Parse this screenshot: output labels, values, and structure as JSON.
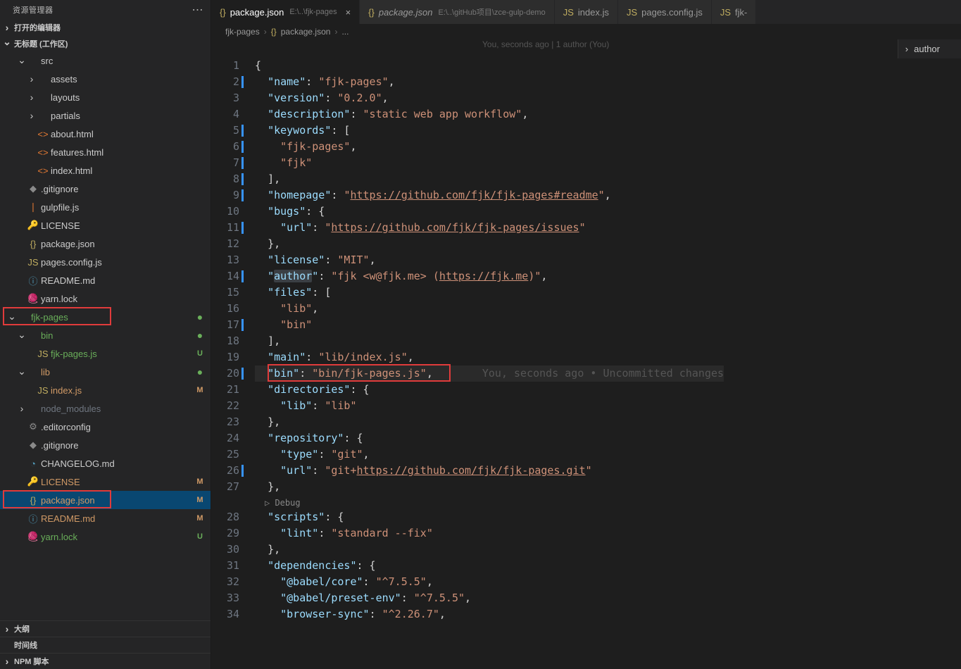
{
  "sidebar": {
    "title": "资源管理器",
    "open_editors": "打开的编辑器",
    "workspace": "无标题 (工作区)",
    "rows": [
      {
        "d": 1,
        "tw": "open",
        "ico": "",
        "lbl": "src",
        "cls": ""
      },
      {
        "d": 2,
        "tw": "closed",
        "ico": "",
        "lbl": "assets",
        "cls": ""
      },
      {
        "d": 2,
        "tw": "closed",
        "ico": "",
        "lbl": "layouts",
        "cls": ""
      },
      {
        "d": 2,
        "tw": "closed",
        "ico": "",
        "lbl": "partials",
        "cls": ""
      },
      {
        "d": 2,
        "tw": "leaf",
        "ico": "<>",
        "iclr": "c-orange",
        "lbl": "about.html",
        "cls": ""
      },
      {
        "d": 2,
        "tw": "leaf",
        "ico": "<>",
        "iclr": "c-orange",
        "lbl": "features.html",
        "cls": ""
      },
      {
        "d": 2,
        "tw": "leaf",
        "ico": "<>",
        "iclr": "c-orange",
        "lbl": "index.html",
        "cls": ""
      },
      {
        "d": 1,
        "tw": "leaf",
        "ico": "◆",
        "iclr": "c-grey",
        "lbl": ".gitignore",
        "cls": ""
      },
      {
        "d": 1,
        "tw": "leaf",
        "ico": "❘",
        "iclr": "c-orange",
        "lbl": "gulpfile.js",
        "cls": ""
      },
      {
        "d": 1,
        "tw": "leaf",
        "ico": "🔑",
        "iclr": "c-yellow",
        "lbl": "LICENSE",
        "cls": ""
      },
      {
        "d": 1,
        "tw": "leaf",
        "ico": "{}",
        "iclr": "c-yellow",
        "lbl": "package.json",
        "cls": ""
      },
      {
        "d": 1,
        "tw": "leaf",
        "ico": "JS",
        "iclr": "c-yellow",
        "lbl": "pages.config.js",
        "cls": ""
      },
      {
        "d": 1,
        "tw": "leaf",
        "ico": "ⓘ",
        "iclr": "c-lightblue",
        "lbl": "README.md",
        "cls": ""
      },
      {
        "d": 1,
        "tw": "leaf",
        "ico": "🧶",
        "iclr": "c-purple",
        "lbl": "yarn.lock",
        "cls": ""
      },
      {
        "d": 0,
        "tw": "open",
        "ico": "",
        "lbl": "fjk-pages",
        "cls": "git-unt",
        "git": "dot",
        "hl": "box1"
      },
      {
        "d": 1,
        "tw": "open",
        "ico": "",
        "lbl": "bin",
        "cls": "git-unt",
        "git": "dot"
      },
      {
        "d": 2,
        "tw": "leaf",
        "ico": "JS",
        "iclr": "c-yellow",
        "lbl": "fjk-pages.js",
        "cls": "git-unt",
        "git": "U"
      },
      {
        "d": 1,
        "tw": "open",
        "ico": "",
        "lbl": "lib",
        "cls": "git-mod",
        "git": "dot"
      },
      {
        "d": 2,
        "tw": "leaf",
        "ico": "JS",
        "iclr": "c-yellow",
        "lbl": "index.js",
        "cls": "git-mod",
        "git": "M"
      },
      {
        "d": 1,
        "tw": "closed",
        "ico": "",
        "lbl": "node_modules",
        "cls": "dim"
      },
      {
        "d": 1,
        "tw": "leaf",
        "ico": "⚙",
        "iclr": "c-grey",
        "lbl": ".editorconfig",
        "cls": ""
      },
      {
        "d": 1,
        "tw": "leaf",
        "ico": "◆",
        "iclr": "c-grey",
        "lbl": ".gitignore",
        "cls": ""
      },
      {
        "d": 1,
        "tw": "leaf",
        "ico": "◔",
        "iclr": "c-lightblue",
        "lbl": "CHANGELOG.md",
        "cls": ""
      },
      {
        "d": 1,
        "tw": "leaf",
        "ico": "🔑",
        "iclr": "c-yellow",
        "lbl": "LICENSE",
        "cls": "git-mod",
        "git": "M"
      },
      {
        "d": 1,
        "tw": "leaf",
        "ico": "{}",
        "iclr": "c-yellow",
        "lbl": "package.json",
        "cls": "git-mod sel",
        "git": "M",
        "hl": "box2"
      },
      {
        "d": 1,
        "tw": "leaf",
        "ico": "ⓘ",
        "iclr": "c-lightblue",
        "lbl": "README.md",
        "cls": "git-mod",
        "git": "M"
      },
      {
        "d": 1,
        "tw": "leaf",
        "ico": "🧶",
        "iclr": "c-purple",
        "lbl": "yarn.lock",
        "cls": "git-unt",
        "git": "U"
      }
    ],
    "bottom": [
      {
        "tw": "closed",
        "lbl": "大纲"
      },
      {
        "tw": "none",
        "lbl": "时间线"
      },
      {
        "tw": "closed",
        "lbl": "NPM 脚本"
      }
    ]
  },
  "tabs": [
    {
      "ico": "{}",
      "iclr": "tico-json",
      "name": "package.json",
      "sub": "E:\\..\\fjk-pages",
      "active": true,
      "close": true
    },
    {
      "ico": "{}",
      "iclr": "tico-json",
      "name": "package.json",
      "sub": "E:\\..\\gitHub项目\\zce-gulp-demo",
      "italic": true
    },
    {
      "ico": "JS",
      "iclr": "tico-js",
      "name": "index.js"
    },
    {
      "ico": "JS",
      "iclr": "tico-js",
      "name": "pages.config.js"
    },
    {
      "ico": "JS",
      "iclr": "tico-js",
      "name": "fjk-"
    }
  ],
  "breadcrumbs": [
    "fjk-pages",
    "›",
    "{}",
    "package.json",
    "›",
    "..."
  ],
  "blame_top": "You, seconds ago | 1 author (You)",
  "outline_label": "author",
  "inline_blame": "You, seconds ago • Uncommitted changes",
  "debug_label": "Debug",
  "code": [
    {
      "n": 1,
      "mod": false,
      "html": "<span class='tok-punc'>{</span>"
    },
    {
      "n": 2,
      "mod": true,
      "html": "  <span class='tok-key'>\"name\"</span><span class='tok-punc'>: </span><span class='tok-str'>\"fjk-pages\"</span><span class='tok-punc'>,</span>"
    },
    {
      "n": 3,
      "mod": false,
      "html": "  <span class='tok-key'>\"version\"</span><span class='tok-punc'>: </span><span class='tok-str'>\"0.2.0\"</span><span class='tok-punc'>,</span>"
    },
    {
      "n": 4,
      "mod": false,
      "html": "  <span class='tok-key'>\"description\"</span><span class='tok-punc'>: </span><span class='tok-str'>\"static web app workflow\"</span><span class='tok-punc'>,</span>"
    },
    {
      "n": 5,
      "mod": true,
      "html": "  <span class='tok-key'>\"keywords\"</span><span class='tok-punc'>: [</span>"
    },
    {
      "n": 6,
      "mod": true,
      "html": "    <span class='tok-str'>\"fjk-pages\"</span><span class='tok-punc'>,</span>"
    },
    {
      "n": 7,
      "mod": true,
      "html": "    <span class='tok-str'>\"fjk\"</span>"
    },
    {
      "n": 8,
      "mod": true,
      "html": "  <span class='tok-punc'>],</span>"
    },
    {
      "n": 9,
      "mod": true,
      "html": "  <span class='tok-key'>\"homepage\"</span><span class='tok-punc'>: </span><span class='tok-str'>\"<span class='tok-link'>https://github.com/fjk/fjk-pages#readme</span>\"</span><span class='tok-punc'>,</span>"
    },
    {
      "n": 10,
      "mod": false,
      "html": "  <span class='tok-key'>\"bugs\"</span><span class='tok-punc'>: {</span>"
    },
    {
      "n": 11,
      "mod": true,
      "html": "    <span class='tok-key'>\"url\"</span><span class='tok-punc'>: </span><span class='tok-str'>\"<span class='tok-link'>https://github.com/fjk/fjk-pages/issues</span>\"</span>"
    },
    {
      "n": 12,
      "mod": false,
      "html": "  <span class='tok-punc'>},</span>"
    },
    {
      "n": 13,
      "mod": false,
      "html": "  <span class='tok-key'>\"license\"</span><span class='tok-punc'>: </span><span class='tok-str'>\"MIT\"</span><span class='tok-punc'>,</span>"
    },
    {
      "n": 14,
      "mod": true,
      "html": "  <span class='tok-key'>\"<span class='sel-word'>author</span>\"</span><span class='tok-punc'>: </span><span class='tok-str'>\"fjk &lt;w@fjk.me&gt; (<span class='tok-link'>https://fjk.me</span>)\"</span><span class='tok-punc'>,</span>"
    },
    {
      "n": 15,
      "mod": false,
      "html": "  <span class='tok-key'>\"files\"</span><span class='tok-punc'>: [</span>"
    },
    {
      "n": 16,
      "mod": false,
      "html": "    <span class='tok-str'>\"lib\"</span><span class='tok-punc'>,</span>"
    },
    {
      "n": 17,
      "mod": true,
      "html": "    <span class='tok-str'>\"bin\"</span>"
    },
    {
      "n": 18,
      "mod": false,
      "html": "  <span class='tok-punc'>],</span>"
    },
    {
      "n": 19,
      "mod": false,
      "html": "  <span class='tok-key'>\"main\"</span><span class='tok-punc'>: </span><span class='tok-str'>\"lib/index.js\"</span><span class='tok-punc'>,</span>"
    },
    {
      "n": 20,
      "mod": true,
      "cur": true,
      "html": "  <span class='tok-key'>\"bin\"</span><span class='tok-punc'>: </span><span class='tok-str'>\"bin/fjk-pages.js\"</span><span class='tok-punc'>,</span><span class='inline-blame'>You, seconds ago • Uncommitted changes</span>"
    },
    {
      "n": 21,
      "mod": false,
      "html": "  <span class='tok-key'>\"directories\"</span><span class='tok-punc'>: {</span>"
    },
    {
      "n": 22,
      "mod": false,
      "html": "    <span class='tok-key'>\"lib\"</span><span class='tok-punc'>: </span><span class='tok-str'>\"lib\"</span>"
    },
    {
      "n": 23,
      "mod": false,
      "html": "  <span class='tok-punc'>},</span>"
    },
    {
      "n": 24,
      "mod": false,
      "html": "  <span class='tok-key'>\"repository\"</span><span class='tok-punc'>: {</span>"
    },
    {
      "n": 25,
      "mod": false,
      "html": "    <span class='tok-key'>\"type\"</span><span class='tok-punc'>: </span><span class='tok-str'>\"git\"</span><span class='tok-punc'>,</span>"
    },
    {
      "n": 26,
      "mod": true,
      "html": "    <span class='tok-key'>\"url\"</span><span class='tok-punc'>: </span><span class='tok-str'>\"git+<span class='tok-link'>https://github.com/fjk/fjk-pages.git</span>\"</span>"
    },
    {
      "n": 27,
      "mod": false,
      "html": "  <span class='tok-punc'>},</span>"
    },
    {
      "debug": true
    },
    {
      "n": 28,
      "mod": false,
      "html": "  <span class='tok-key'>\"scripts\"</span><span class='tok-punc'>: {</span>"
    },
    {
      "n": 29,
      "mod": false,
      "html": "    <span class='tok-key'>\"lint\"</span><span class='tok-punc'>: </span><span class='tok-str'>\"standard --fix\"</span>"
    },
    {
      "n": 30,
      "mod": false,
      "html": "  <span class='tok-punc'>},</span>"
    },
    {
      "n": 31,
      "mod": false,
      "html": "  <span class='tok-key'>\"dependencies\"</span><span class='tok-punc'>: {</span>"
    },
    {
      "n": 32,
      "mod": false,
      "html": "    <span class='tok-key'>\"@babel/core\"</span><span class='tok-punc'>: </span><span class='tok-str'>\"^7.5.5\"</span><span class='tok-punc'>,</span>"
    },
    {
      "n": 33,
      "mod": false,
      "html": "    <span class='tok-key'>\"@babel/preset-env\"</span><span class='tok-punc'>: </span><span class='tok-str'>\"^7.5.5\"</span><span class='tok-punc'>,</span>"
    },
    {
      "n": 34,
      "mod": false,
      "html": "    <span class='tok-key'>\"browser-sync\"</span><span class='tok-punc'>: </span><span class='tok-str'>\"^2.26.7\"</span><span class='tok-punc'>,</span>"
    }
  ]
}
